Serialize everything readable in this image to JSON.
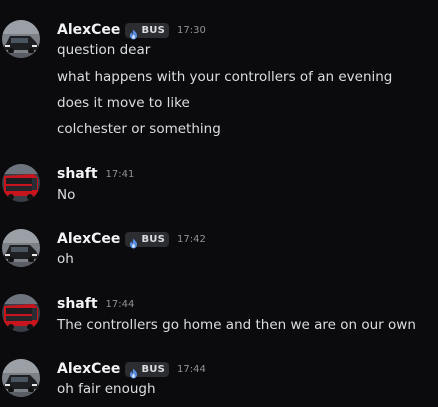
{
  "users": {
    "alexcee": {
      "name": "AlexCee",
      "tag": "BUS",
      "tag_icon": "flame-icon",
      "tag_icon_color": "#5a8ee0",
      "avatar": "car-avatar"
    },
    "shaft": {
      "name": "shaft",
      "avatar": "red-bus-avatar"
    }
  },
  "messages": [
    {
      "author": "AlexCee",
      "tag": "BUS",
      "time": "17:30",
      "lines": [
        "question dear",
        "what happens with your controllers of an evening",
        "does it move to like",
        "colchester or something"
      ]
    },
    {
      "author": "shaft",
      "time": "17:41",
      "lines": [
        "No"
      ]
    },
    {
      "author": "AlexCee",
      "tag": "BUS",
      "time": "17:42",
      "lines": [
        "oh"
      ]
    },
    {
      "author": "shaft",
      "time": "17:44",
      "lines": [
        "The controllers go home and then we are on our own"
      ]
    },
    {
      "author": "AlexCee",
      "tag": "BUS",
      "time": "17:44",
      "lines": [
        "oh fair enough"
      ]
    }
  ],
  "colors": {
    "background": "#0b0b0e",
    "username": "#f2f3f5",
    "message_text": "#dbdee1",
    "timestamp": "#8e9297",
    "tag_background": "#2b2d31"
  }
}
